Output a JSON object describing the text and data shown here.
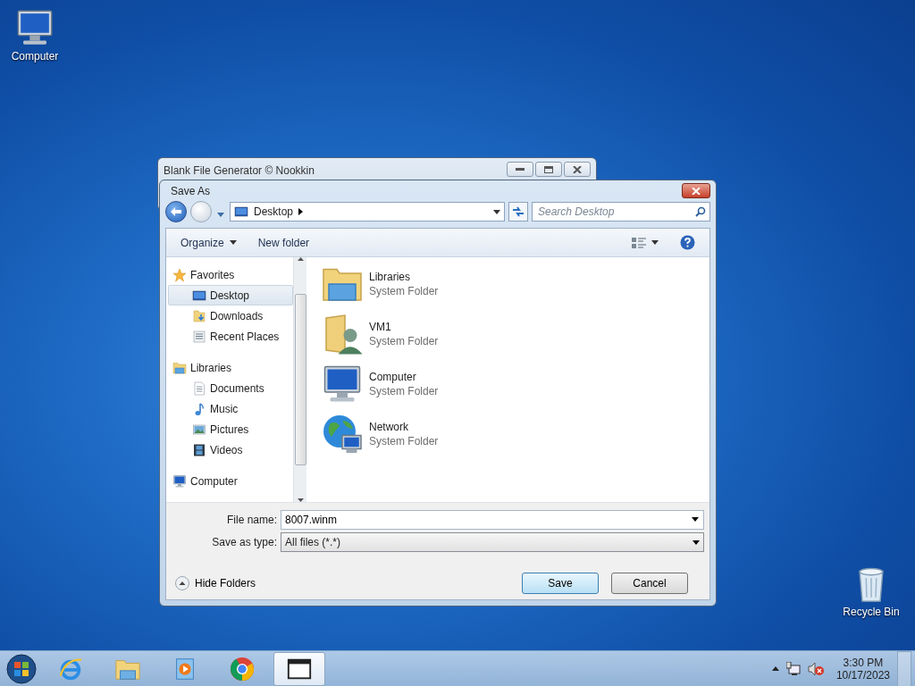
{
  "desktop_icons": [
    {
      "label": "Computer",
      "kind": "computer"
    },
    {
      "label": "Recycle Bin",
      "kind": "recycle"
    }
  ],
  "back_window": {
    "title": "Blank File Generator © Nookkin"
  },
  "dialog": {
    "title": "Save As",
    "address": {
      "location": "Desktop"
    },
    "search": {
      "placeholder": "Search Desktop"
    },
    "toolbar": {
      "organize": "Organize",
      "new_folder": "New folder"
    },
    "nav": [
      {
        "label": "Favorites",
        "kind": "star",
        "selected": false,
        "children": [
          {
            "label": "Desktop",
            "kind": "desktop",
            "selected": true
          },
          {
            "label": "Downloads",
            "kind": "downloads",
            "selected": false
          },
          {
            "label": "Recent Places",
            "kind": "recent",
            "selected": false
          }
        ]
      },
      {
        "label": "Libraries",
        "kind": "libraries",
        "selected": false,
        "children": [
          {
            "label": "Documents",
            "kind": "document",
            "selected": false
          },
          {
            "label": "Music",
            "kind": "music",
            "selected": false
          },
          {
            "label": "Pictures",
            "kind": "pictures",
            "selected": false
          },
          {
            "label": "Videos",
            "kind": "videos",
            "selected": false
          }
        ]
      },
      {
        "label": "Computer",
        "kind": "computer",
        "selected": false
      }
    ],
    "items": [
      {
        "name": "Libraries",
        "type": "System Folder",
        "kind": "libraries"
      },
      {
        "name": "VM1",
        "type": "System Folder",
        "kind": "user"
      },
      {
        "name": "Computer",
        "type": "System Folder",
        "kind": "computer"
      },
      {
        "name": "Network",
        "type": "System Folder",
        "kind": "network"
      }
    ],
    "file_name": {
      "label": "File name:",
      "value": "8007.winm"
    },
    "save_type": {
      "label": "Save as type:",
      "value": "All files (*.*)"
    },
    "hide_folders": "Hide Folders",
    "buttons": [
      {
        "label": "Save",
        "default": true
      },
      {
        "label": "Cancel",
        "default": false
      }
    ]
  },
  "taskbar": {
    "apps": [
      {
        "kind": "ie",
        "active": false
      },
      {
        "kind": "explorer",
        "active": false
      },
      {
        "kind": "media",
        "active": false
      },
      {
        "kind": "chrome",
        "active": false
      },
      {
        "kind": "window",
        "active": true
      }
    ],
    "time": "3:30 PM",
    "date": "10/17/2023"
  }
}
